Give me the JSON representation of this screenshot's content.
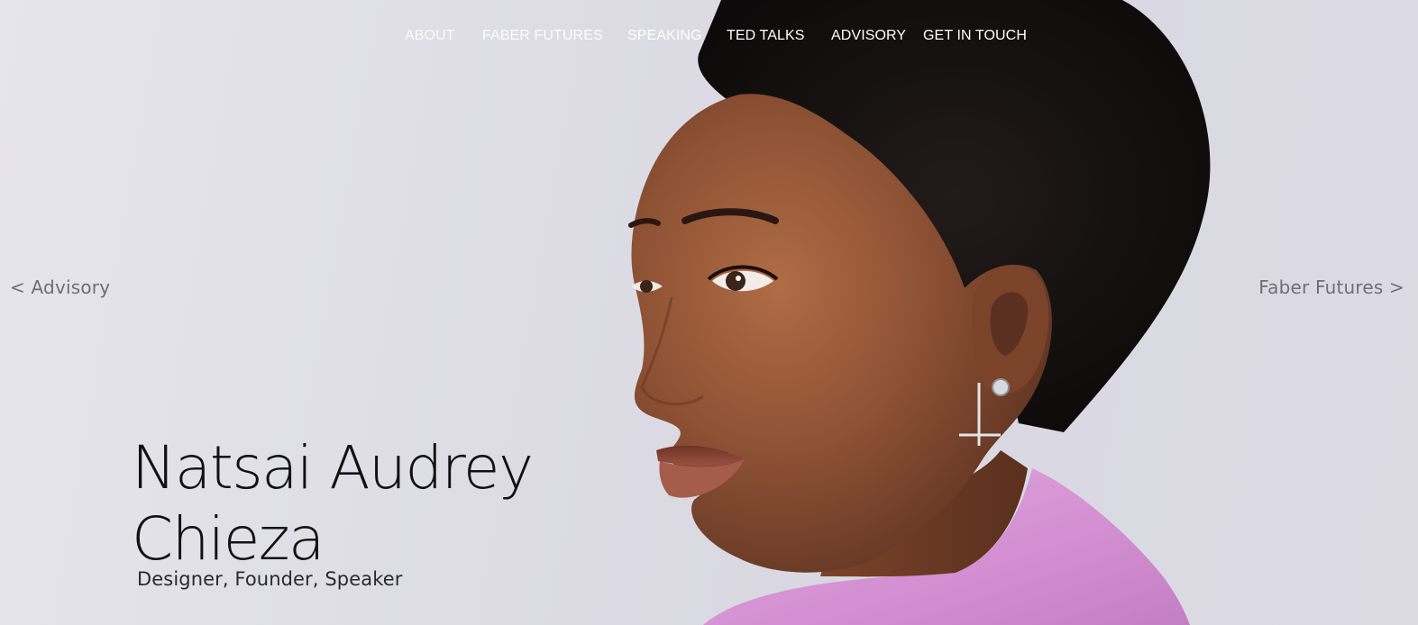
{
  "nav": {
    "items": [
      {
        "label": "ABOUT"
      },
      {
        "label": "FABER FUTURES"
      },
      {
        "label": "SPEAKING"
      },
      {
        "label": "TED TALKS"
      },
      {
        "label": "ADVISORY"
      },
      {
        "label": "GET IN TOUCH"
      }
    ]
  },
  "slider": {
    "prev_label": "< Advisory",
    "next_label": "Faber Futures >"
  },
  "hero": {
    "name_line1": "Natsai Audrey",
    "name_line2": "Chieza",
    "tagline": "Designer, Founder, Speaker",
    "image_subject": "portrait photo of a woman in profile",
    "colors": {
      "background": "#dedde5",
      "skin": "#8a4f33",
      "hair": "#141112",
      "top": "#d99ad6"
    }
  }
}
